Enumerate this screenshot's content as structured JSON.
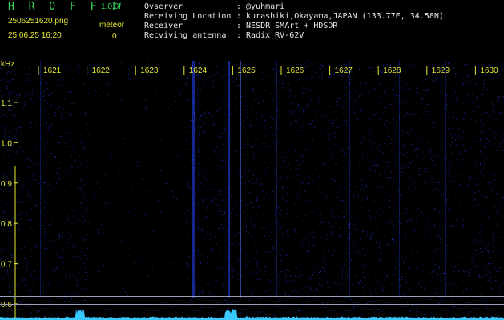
{
  "app": {
    "title": "H R O F F T",
    "version": "1.0.0f"
  },
  "file": {
    "name": "2506251620.png",
    "datetime": "25.06.25 16:20"
  },
  "meteor": {
    "label": "meteor",
    "count": "0"
  },
  "info": {
    "observer_key": "Ovserver",
    "observer_val": ": @yuhmari",
    "location_key": "Receiving Location",
    "location_val": ": kurashiki,Okayama,JAPAN (133.77E, 34.58N)",
    "receiver_key": "Receiver",
    "receiver_val": ": NESDR SMArt + HDSDR",
    "antenna_key": "Recviving antenna",
    "antenna_val": ": Radix RV-62V"
  },
  "axis": {
    "x_unit": "kHz",
    "x_ticks": [
      "1621",
      "1622",
      "1623",
      "1624",
      "1625",
      "1626",
      "1627",
      "1628",
      "1629",
      "1630"
    ],
    "y_ticks": [
      "1.1",
      "1.0",
      "0.9",
      "0.8",
      "0.7",
      "0.6"
    ]
  },
  "colors": {
    "background": "#000000",
    "text_green": "#38d95a",
    "text_yellow": "#e8e832",
    "noise_blue": "#2233cc",
    "signal_cyan": "#39c8ff"
  }
}
